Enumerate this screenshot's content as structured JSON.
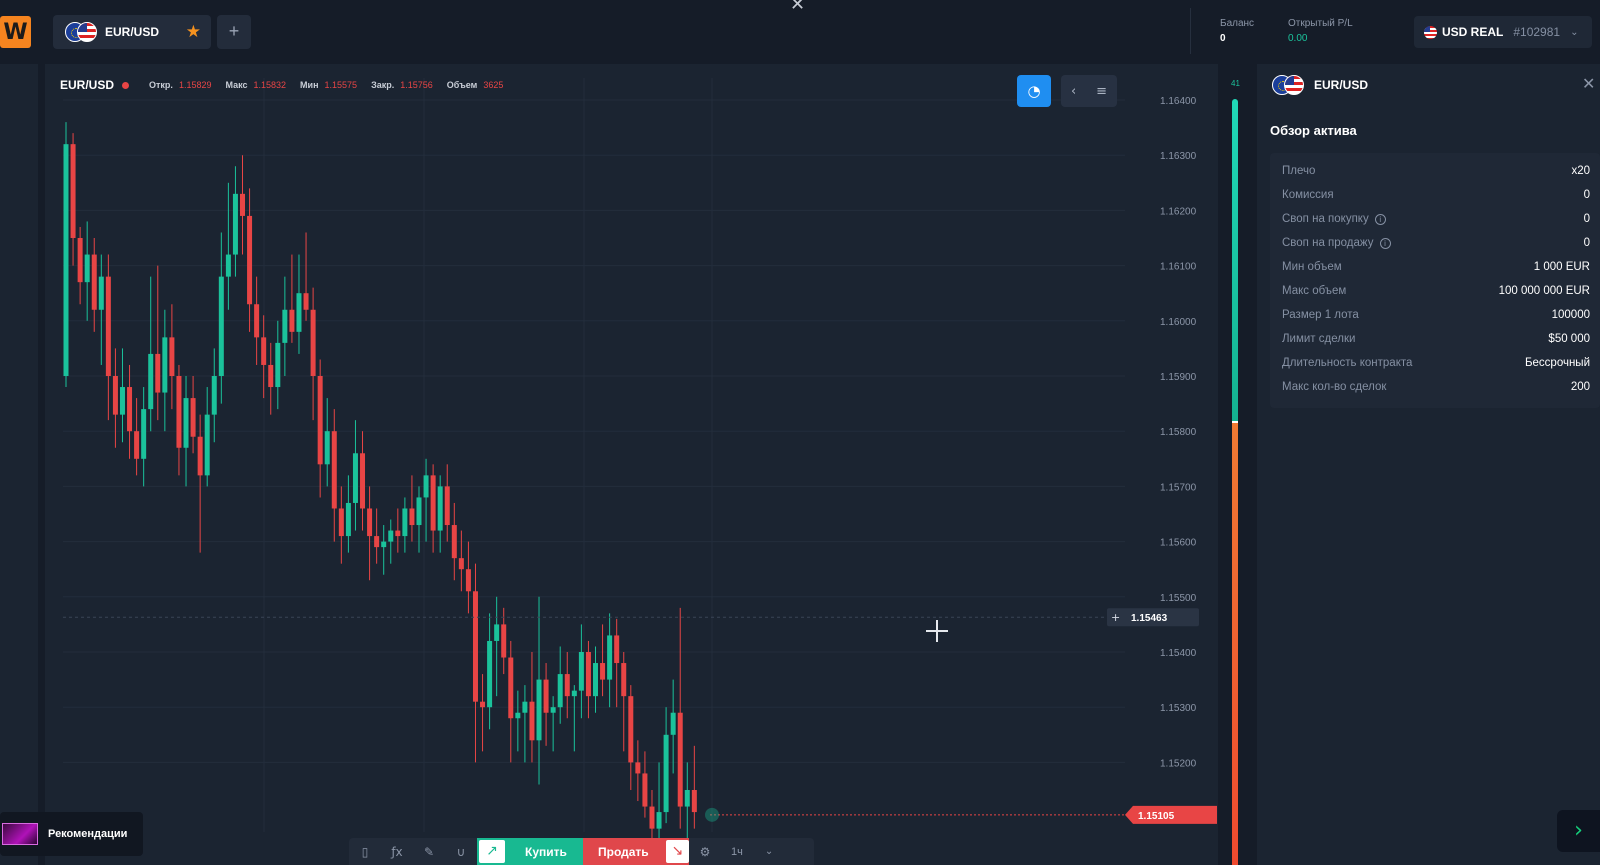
{
  "topbar": {
    "logo": "W",
    "tab": {
      "symbol": "EUR/USD"
    },
    "add_tab": "+",
    "balance": {
      "label": "Баланс",
      "value": "0"
    },
    "open_pl": {
      "label": "Открытый P/L",
      "value": "0.00"
    },
    "account": {
      "type": "USD REAL",
      "id": "#102981"
    }
  },
  "chart_header": {
    "symbol": "EUR/USD",
    "open_label": "Откр.",
    "open": "1.15829",
    "high_label": "Макс",
    "high": "1.15832",
    "low_label": "Мин",
    "low": "1.15575",
    "close_label": "Закр.",
    "close": "1.15756",
    "volume_label": "Объем",
    "volume": "3625"
  },
  "chart_data": {
    "type": "candlestick",
    "ylim": [
      1.151,
      1.1644
    ],
    "y_ticks": [
      "1.16400",
      "1.16300",
      "1.16200",
      "1.16100",
      "1.16000",
      "1.15900",
      "1.15800",
      "1.15700",
      "1.15600",
      "1.15500",
      "1.15400",
      "1.15300",
      "1.15200"
    ],
    "crosshair_price": "1.15463",
    "current_price": "1.15105",
    "up_color": "#1bc29b",
    "down_color": "#e84545",
    "candles": [
      [
        1.159,
        1.1636,
        1.1588,
        1.1632
      ],
      [
        1.1632,
        1.1634,
        1.161,
        1.1615
      ],
      [
        1.1615,
        1.1617,
        1.1603,
        1.1607
      ],
      [
        1.1607,
        1.1618,
        1.16,
        1.1612
      ],
      [
        1.1612,
        1.1615,
        1.1598,
        1.1602
      ],
      [
        1.1602,
        1.1612,
        1.1592,
        1.1608
      ],
      [
        1.1608,
        1.1612,
        1.1582,
        1.159
      ],
      [
        1.159,
        1.1595,
        1.1577,
        1.1583
      ],
      [
        1.1583,
        1.1595,
        1.1578,
        1.1588
      ],
      [
        1.1588,
        1.1592,
        1.1575,
        1.158
      ],
      [
        1.158,
        1.1586,
        1.1572,
        1.1575
      ],
      [
        1.1575,
        1.1588,
        1.157,
        1.1584
      ],
      [
        1.1584,
        1.1608,
        1.158,
        1.1594
      ],
      [
        1.1594,
        1.161,
        1.1582,
        1.1587
      ],
      [
        1.1587,
        1.1602,
        1.158,
        1.1597
      ],
      [
        1.1597,
        1.1603,
        1.1584,
        1.159
      ],
      [
        1.159,
        1.1592,
        1.1572,
        1.1577
      ],
      [
        1.1577,
        1.159,
        1.157,
        1.1586
      ],
      [
        1.1586,
        1.159,
        1.1576,
        1.1579
      ],
      [
        1.1579,
        1.1583,
        1.1558,
        1.1572
      ],
      [
        1.1572,
        1.1588,
        1.157,
        1.1583
      ],
      [
        1.1583,
        1.1595,
        1.1578,
        1.159
      ],
      [
        1.159,
        1.1616,
        1.1585,
        1.1608
      ],
      [
        1.1608,
        1.1625,
        1.1602,
        1.1612
      ],
      [
        1.1612,
        1.1628,
        1.1608,
        1.1623
      ],
      [
        1.1623,
        1.163,
        1.1612,
        1.1619
      ],
      [
        1.1619,
        1.1624,
        1.1598,
        1.1603
      ],
      [
        1.1603,
        1.1608,
        1.1592,
        1.1597
      ],
      [
        1.1597,
        1.1601,
        1.1586,
        1.1592
      ],
      [
        1.1592,
        1.1596,
        1.1583,
        1.1588
      ],
      [
        1.1588,
        1.16,
        1.1584,
        1.1596
      ],
      [
        1.1596,
        1.1608,
        1.159,
        1.1602
      ],
      [
        1.1602,
        1.1612,
        1.1596,
        1.1598
      ],
      [
        1.1598,
        1.1612,
        1.1594,
        1.1605
      ],
      [
        1.1605,
        1.1616,
        1.16,
        1.1602
      ],
      [
        1.1602,
        1.1606,
        1.1582,
        1.159
      ],
      [
        1.159,
        1.1593,
        1.1568,
        1.1574
      ],
      [
        1.1574,
        1.1586,
        1.157,
        1.158
      ],
      [
        1.158,
        1.1584,
        1.156,
        1.1566
      ],
      [
        1.1566,
        1.157,
        1.1556,
        1.1561
      ],
      [
        1.1561,
        1.1572,
        1.1558,
        1.1567
      ],
      [
        1.1567,
        1.1582,
        1.1562,
        1.1576
      ],
      [
        1.1576,
        1.158,
        1.1562,
        1.1566
      ],
      [
        1.1566,
        1.157,
        1.1553,
        1.1561
      ],
      [
        1.1561,
        1.1566,
        1.1556,
        1.1559
      ],
      [
        1.1559,
        1.1563,
        1.1554,
        1.156
      ],
      [
        1.156,
        1.1564,
        1.1556,
        1.1562
      ],
      [
        1.1562,
        1.1566,
        1.1558,
        1.1561
      ],
      [
        1.1561,
        1.1568,
        1.1558,
        1.1566
      ],
      [
        1.1566,
        1.1572,
        1.156,
        1.1563
      ],
      [
        1.1563,
        1.157,
        1.1558,
        1.1568
      ],
      [
        1.1568,
        1.1575,
        1.156,
        1.1572
      ],
      [
        1.1572,
        1.1574,
        1.1558,
        1.1562
      ],
      [
        1.1562,
        1.1572,
        1.1558,
        1.157
      ],
      [
        1.157,
        1.1574,
        1.156,
        1.1563
      ],
      [
        1.1563,
        1.1567,
        1.1553,
        1.1557
      ],
      [
        1.1557,
        1.1562,
        1.1551,
        1.1555
      ],
      [
        1.1555,
        1.156,
        1.1547,
        1.1551
      ],
      [
        1.1551,
        1.1556,
        1.152,
        1.1531
      ],
      [
        1.1531,
        1.1536,
        1.1522,
        1.153
      ],
      [
        1.153,
        1.1547,
        1.1526,
        1.1542
      ],
      [
        1.1542,
        1.155,
        1.1532,
        1.1545
      ],
      [
        1.1545,
        1.1548,
        1.1536,
        1.1539
      ],
      [
        1.1539,
        1.1542,
        1.152,
        1.1528
      ],
      [
        1.1528,
        1.1533,
        1.1522,
        1.1529
      ],
      [
        1.1529,
        1.1534,
        1.152,
        1.1531
      ],
      [
        1.1531,
        1.154,
        1.152,
        1.1524
      ],
      [
        1.1524,
        1.155,
        1.1516,
        1.1535
      ],
      [
        1.1535,
        1.1538,
        1.1523,
        1.1529
      ],
      [
        1.1529,
        1.1532,
        1.1522,
        1.153
      ],
      [
        1.153,
        1.1541,
        1.1527,
        1.1536
      ],
      [
        1.1536,
        1.154,
        1.1528,
        1.1532
      ],
      [
        1.1532,
        1.1534,
        1.1522,
        1.1533
      ],
      [
        1.1533,
        1.1545,
        1.1528,
        1.154
      ],
      [
        1.154,
        1.1542,
        1.1528,
        1.1532
      ],
      [
        1.1532,
        1.1541,
        1.1529,
        1.1538
      ],
      [
        1.1538,
        1.1545,
        1.1532,
        1.1535
      ],
      [
        1.1535,
        1.1547,
        1.153,
        1.1543
      ],
      [
        1.1543,
        1.1546,
        1.153,
        1.1538
      ],
      [
        1.1538,
        1.154,
        1.1522,
        1.1532
      ],
      [
        1.1532,
        1.1534,
        1.1515,
        1.152
      ],
      [
        1.152,
        1.1524,
        1.1513,
        1.1518
      ],
      [
        1.1518,
        1.1522,
        1.151,
        1.1512
      ],
      [
        1.1512,
        1.1515,
        1.1506,
        1.1508
      ],
      [
        1.1508,
        1.152,
        1.1506,
        1.1511
      ],
      [
        1.1511,
        1.153,
        1.1509,
        1.1525
      ],
      [
        1.1525,
        1.1535,
        1.1518,
        1.1529
      ],
      [
        1.1529,
        1.1548,
        1.1508,
        1.1512
      ],
      [
        1.1512,
        1.152,
        1.1506,
        1.1515
      ],
      [
        1.1515,
        1.1523,
        1.1508,
        1.1511
      ]
    ]
  },
  "toolbar": {
    "buy": "Купить",
    "sell": "Продать",
    "timeframe": "1ч"
  },
  "recommendations": "Рекомендации",
  "sidepanel": {
    "symbol": "EUR/USD",
    "title": "Обзор актива",
    "rows": [
      {
        "label": "Плечо",
        "value": "x20"
      },
      {
        "label": "Комиссия",
        "value": "0"
      },
      {
        "label": "Своп на покупку",
        "value": "0"
      },
      {
        "label": "Своп на продажу",
        "value": "0"
      },
      {
        "label": "Мин объем",
        "value": "1 000 EUR"
      },
      {
        "label": "Макс объем",
        "value": "100 000 000 EUR"
      },
      {
        "label": "Размер 1 лота",
        "value": "100000"
      },
      {
        "label": "Лимит сделки",
        "value": "$50 000"
      },
      {
        "label": "Длительность контракта",
        "value": "Бессрочный"
      },
      {
        "label": "Макс кол-во сделок",
        "value": "200"
      }
    ]
  },
  "sentiment": {
    "buy_fraction": 0.42,
    "label": "41"
  }
}
